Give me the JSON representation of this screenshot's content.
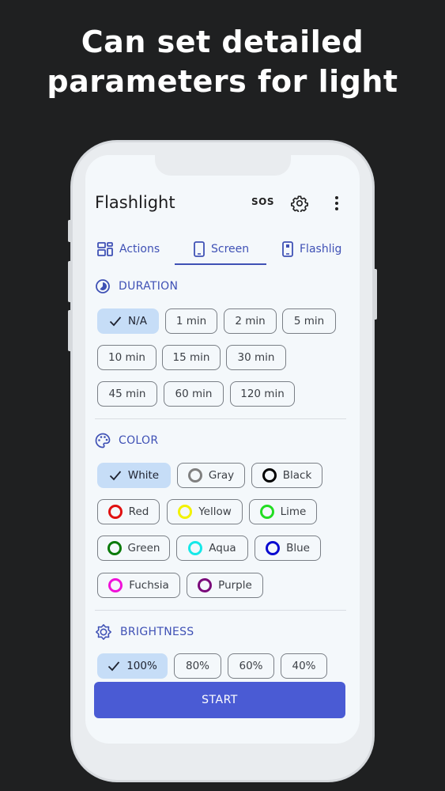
{
  "headline": {
    "line1": "Can set detailed",
    "line2": "parameters for light"
  },
  "app": {
    "title": "Flashlight",
    "sos_label": "SOS",
    "icons": {
      "settings": "gear-icon",
      "more": "more-vert-icon"
    }
  },
  "tabs": [
    {
      "label": "Actions",
      "icon": "dashboard-icon",
      "selected": false
    },
    {
      "label": "Screen",
      "icon": "phone-icon",
      "selected": true
    },
    {
      "label": "Flashlig",
      "icon": "phone-flash-icon",
      "selected": false
    }
  ],
  "duration": {
    "title": "DURATION",
    "icon": "timelapse-icon",
    "options": [
      "N/A",
      "1 min",
      "2 min",
      "5 min",
      "10 min",
      "15 min",
      "30 min",
      "45 min",
      "60 min",
      "120 min"
    ],
    "selected": "N/A"
  },
  "color": {
    "title": "COLOR",
    "icon": "palette-icon",
    "options": [
      {
        "label": "White",
        "color": "#ffffff"
      },
      {
        "label": "Gray",
        "color": "#808080"
      },
      {
        "label": "Black",
        "color": "#000000"
      },
      {
        "label": "Red",
        "color": "#e01010"
      },
      {
        "label": "Yellow",
        "color": "#f2f200"
      },
      {
        "label": "Lime",
        "color": "#22dd22"
      },
      {
        "label": "Green",
        "color": "#0a7a0a"
      },
      {
        "label": "Aqua",
        "color": "#16e8e8"
      },
      {
        "label": "Blue",
        "color": "#0a0ad0"
      },
      {
        "label": "Fuchsia",
        "color": "#f012d8"
      },
      {
        "label": "Purple",
        "color": "#7a0a7a"
      }
    ],
    "selected": "White"
  },
  "brightness": {
    "title": "BRIGHTNESS",
    "icon": "brightness-icon",
    "options": [
      "100%",
      "80%",
      "60%",
      "40%"
    ],
    "selected": "100%"
  },
  "start_label": "START",
  "accent": "#3f51b5"
}
